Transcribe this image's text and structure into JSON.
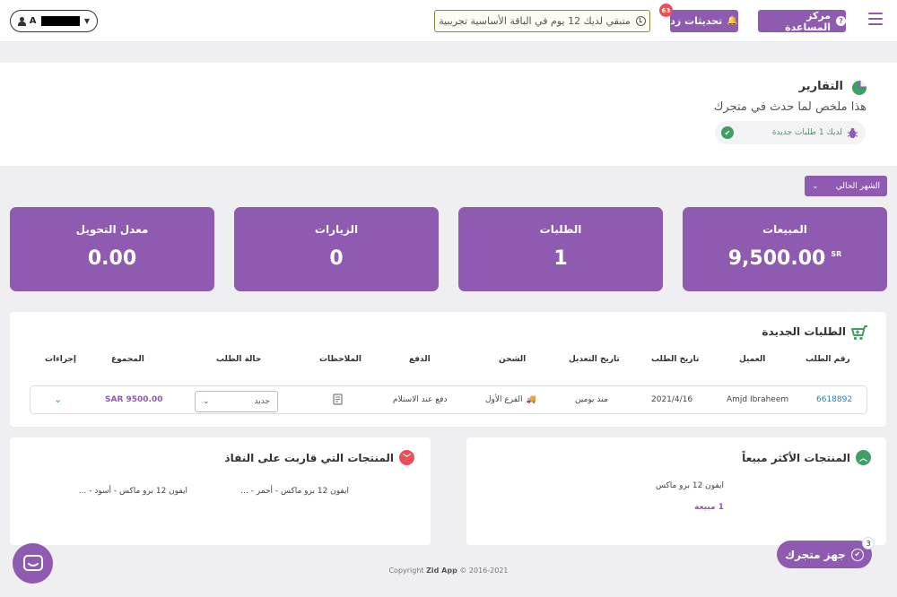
{
  "header": {
    "help_label": "مركز المساعدة",
    "updates_label": "تحديثات زد",
    "updates_count": "63",
    "trial_text": "متبقي لديك 12 يوم في الباقة الأساسية تجريبية",
    "user_initial": "A"
  },
  "reports": {
    "title": "التقارير",
    "subtitle": "هذا ملخص لما حدث في متجرك",
    "new_orders_notice": "لديك 1 طلبات جديدة"
  },
  "period_filter": {
    "selected": "الشهر الحالي"
  },
  "stats": [
    {
      "label": "المبيعات",
      "value": "9,500.00",
      "currency": "SR"
    },
    {
      "label": "الطلبات",
      "value": "1"
    },
    {
      "label": "الزيارات",
      "value": "0"
    },
    {
      "label": "معدل التحويل",
      "value": "0.00"
    }
  ],
  "new_orders": {
    "title": "الطلبات الجديدة",
    "columns": {
      "order_no": "رقم الطلب",
      "customer": "العميل",
      "order_date": "تاريخ الطلب",
      "modified_date": "تاريخ التعديل",
      "shipping": "الشحن",
      "payment": "الدفع",
      "notes": "الملاحظات",
      "status": "حالة الطلب",
      "total": "المجموع",
      "actions": "إجراءات"
    },
    "rows": [
      {
        "order_no": "6618892",
        "customer": "Amjd Ibraheem",
        "order_date": "2021/4/16",
        "modified_date": "منذ يومين",
        "shipping": "الفرع الأول",
        "payment": "دفع عند الاستلام",
        "status": "جديد",
        "total": "SAR 9500.00"
      }
    ]
  },
  "best_selling": {
    "title": "المنتجات الأكثر مبيعاً",
    "items": [
      {
        "name": "ايفون 12 برو ماكس",
        "sales": "1 مبيعة"
      }
    ]
  },
  "low_stock": {
    "title": "المنتجات التي قاربت على النفاذ",
    "items": [
      "ايفون 12 برو ماكس - أحمر - ...",
      "ايفون 12 برو ماكس - أسود - ..."
    ]
  },
  "footer": {
    "prefix": "Copyright",
    "brand": "Zid App",
    "years": "© 2016-2021"
  },
  "store_ready": {
    "label": "جهز متجرك",
    "count": "3"
  },
  "colors": {
    "primary": "#8e5bb0",
    "success": "#3f9d66",
    "danger": "#e8505b",
    "link": "#2a7fc0"
  }
}
